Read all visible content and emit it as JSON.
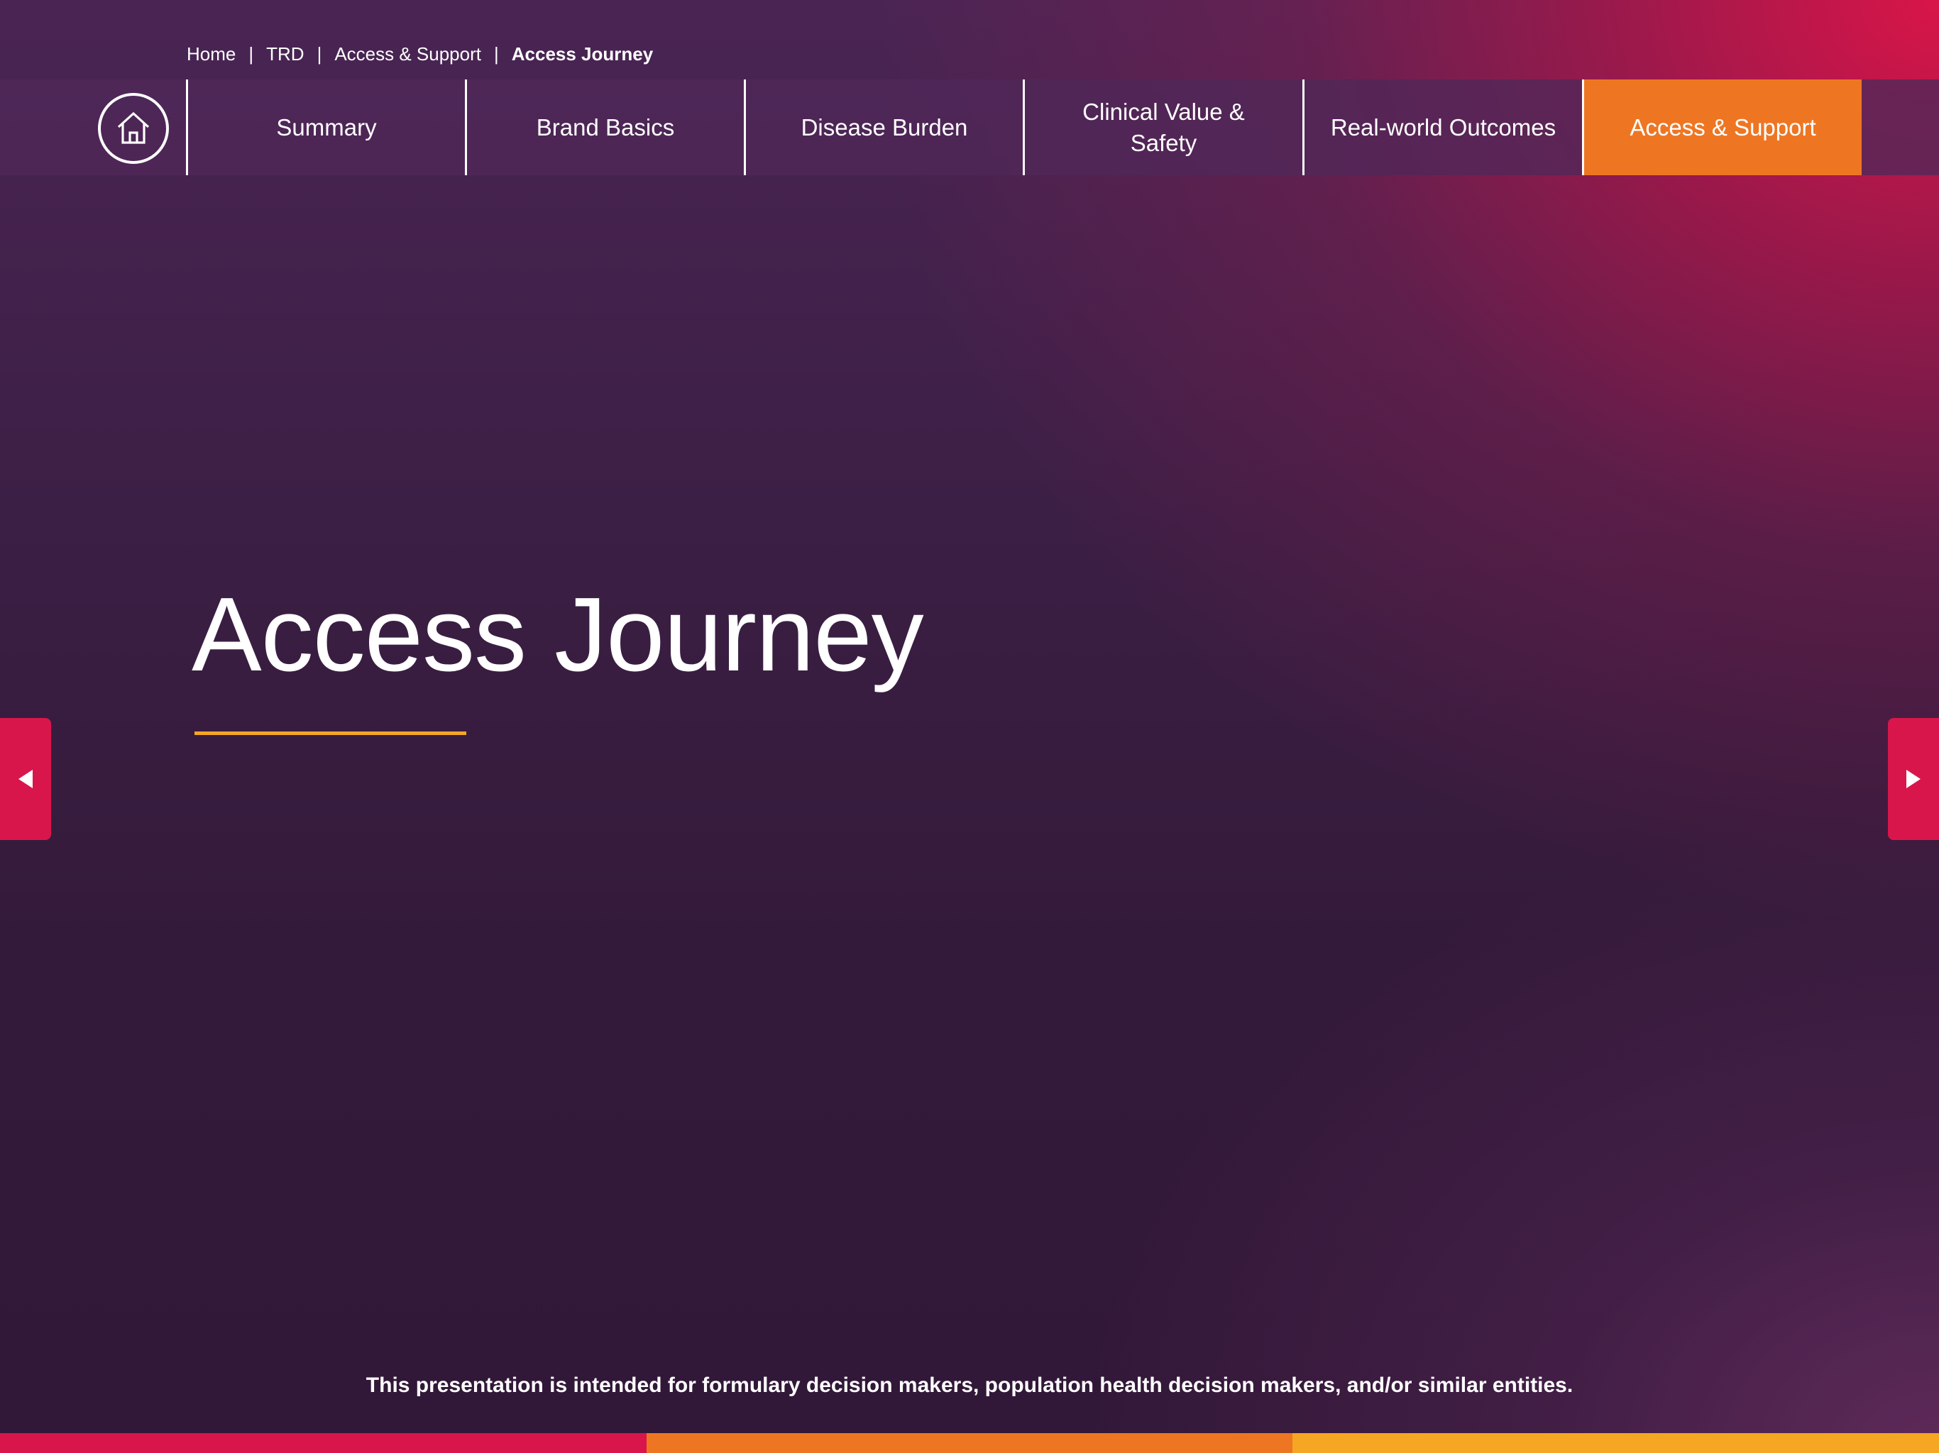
{
  "breadcrumb": {
    "items": [
      "Home",
      "TRD",
      "Access & Support",
      "Access Journey"
    ],
    "separator": "|"
  },
  "nav": {
    "home_icon": "home-icon",
    "tabs": [
      {
        "label": "Summary",
        "active": false
      },
      {
        "label": "Brand Basics",
        "active": false
      },
      {
        "label": "Disease Burden",
        "active": false
      },
      {
        "label": "Clinical Value & Safety",
        "active": false
      },
      {
        "label": "Real-world Outcomes",
        "active": false
      },
      {
        "label": "Access & Support",
        "active": true
      }
    ]
  },
  "hero": {
    "title": "Access Journey"
  },
  "arrows": {
    "prev_icon": "triangle-left-icon",
    "next_icon": "triangle-right-icon"
  },
  "footer": {
    "disclaimer": "This presentation is intended for formulary decision makers, population health decision makers, and/or similar entities."
  },
  "colors": {
    "active_tab": "#ee7623",
    "accent_line": "#f5a623",
    "arrow_bg": "#d9164c",
    "bar_segments": [
      "#d9164c",
      "#ee7623",
      "#f5a623"
    ]
  }
}
